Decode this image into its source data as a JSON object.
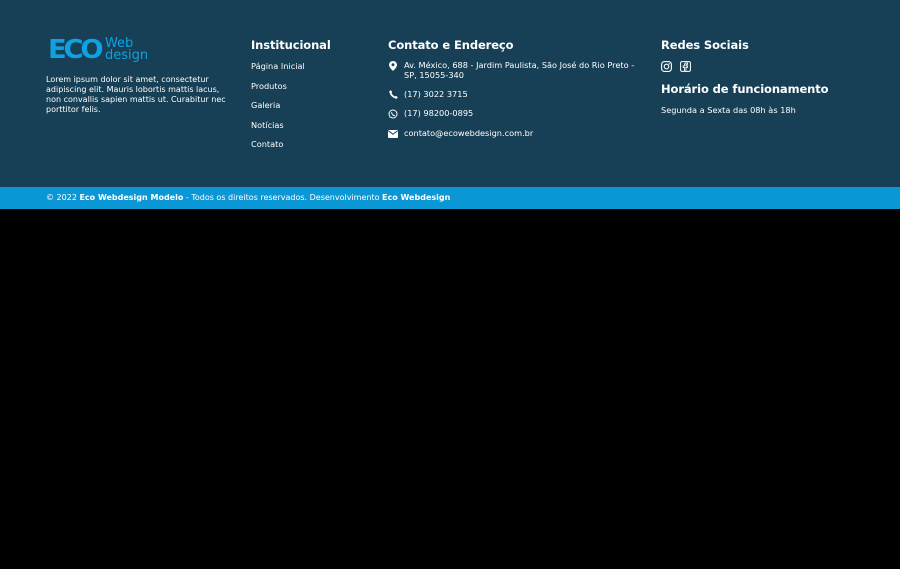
{
  "brand": {
    "logo_main": "ECO",
    "logo_line1": "Web",
    "logo_line2": "design",
    "about": "Lorem ipsum dolor sit amet, consectetur adipiscing elit. Mauris lobortis mattis lacus, non convallis sapien mattis ut. Curabitur nec porttitor felis.",
    "accent_color": "#0fa2e3"
  },
  "institucional": {
    "title": "Institucional",
    "links": [
      {
        "label": "Página Inicial"
      },
      {
        "label": "Produtos"
      },
      {
        "label": "Galeria"
      },
      {
        "label": "Notícias"
      },
      {
        "label": "Contato"
      }
    ]
  },
  "contact": {
    "title": "Contato e Endereço",
    "address": "Av. México, 688 - Jardim Paulista, São José do Rio Preto - SP, 15055-340",
    "phone": "(17) 3022 3715",
    "whatsapp": "(17) 98200-0895",
    "email": "contato@ecowebdesign.com.br",
    "icons": [
      "map-pin-icon",
      "phone-icon",
      "whatsapp-icon",
      "envelope-icon"
    ]
  },
  "social": {
    "title": "Redes Sociais",
    "icons": [
      "instagram-icon",
      "facebook-icon"
    ]
  },
  "hours": {
    "title": "Horário de funcionamento",
    "text": "Segunda a Sexta das 08h às 18h"
  },
  "copyright": {
    "prefix": "© 2022",
    "site_name": "Eco Webdesign Modelo",
    "middle": "- Todos os direitos reservados. Desenvolvimento",
    "developer": "Eco Webdesign"
  },
  "colors": {
    "footer_bg": "#173f55",
    "bar_bg": "#0b97d6",
    "page_bg": "#000000"
  }
}
